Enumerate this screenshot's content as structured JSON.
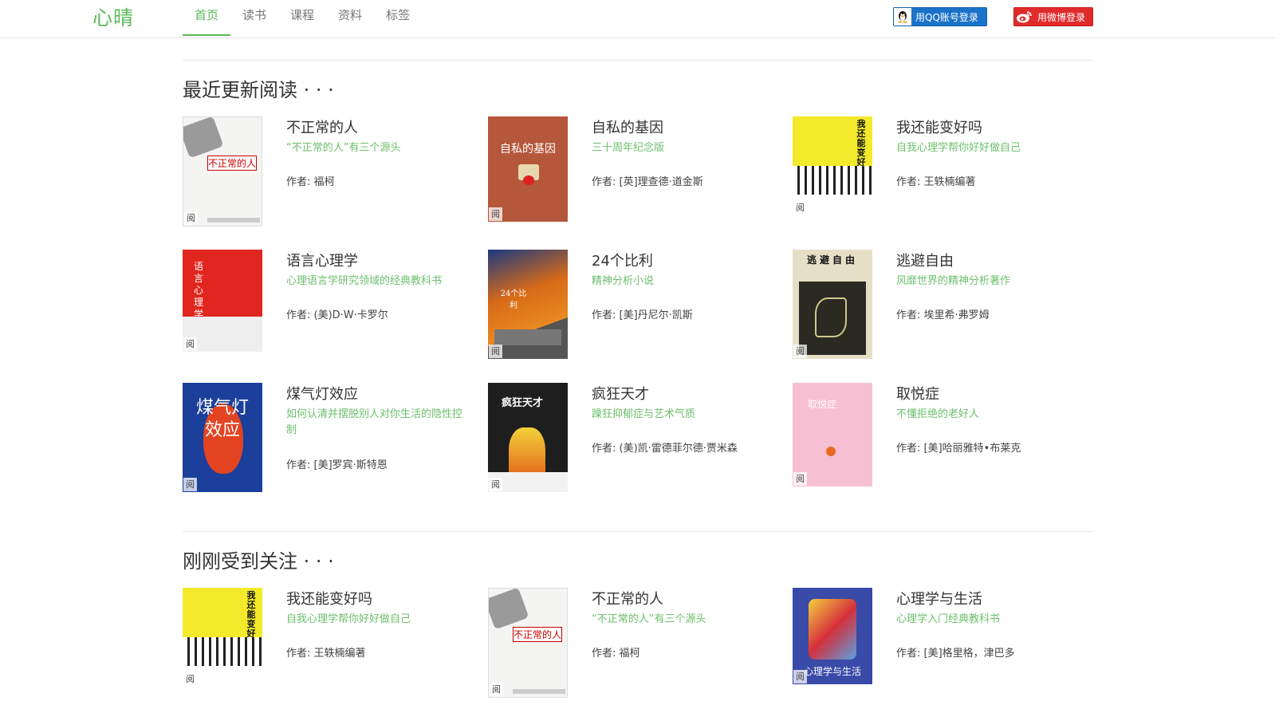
{
  "header": {
    "logo": "心晴",
    "nav": [
      "首页",
      "读书",
      "课程",
      "资料",
      "标签"
    ],
    "login_qq": "用QQ账号登录",
    "login_weibo": "用微博登录"
  },
  "sections": {
    "recent": {
      "title": "最近更新阅读 · · ·",
      "books": [
        {
          "title": "不正常的人",
          "subtitle": "“不正常的人”有三个源头",
          "author": "作者: 福柯",
          "cover_text": "不正常的人"
        },
        {
          "title": "自私的基因",
          "subtitle": "三十周年纪念版",
          "author": "作者: [英]理查德·道金斯",
          "cover_text": "自私的基因"
        },
        {
          "title": "我还能变好吗",
          "subtitle": "自我心理学帮你好好做自己",
          "author": "作者: 王轶楠编著",
          "cover_text": "我还能变好吗"
        },
        {
          "title": "语言心理学",
          "subtitle": "心理语言学研究领域的经典教科书",
          "author": "作者: (美)D·W·卡罗尔",
          "cover_text": "语言心理学"
        },
        {
          "title": "24个比利",
          "subtitle": "精神分析小说",
          "author": "作者: [美]丹尼尔·凯斯",
          "cover_text": "24个比利"
        },
        {
          "title": "逃避自由",
          "subtitle": "风靡世界的精神分析著作",
          "author": "作者: 埃里希·弗罗姆",
          "cover_text": "逃避自由"
        },
        {
          "title": "煤气灯效应",
          "subtitle": "如何认清并摆脱别人对你生活的隐性控制",
          "author": "作者: [美]罗宾·斯特恩",
          "cover_text": "煤气灯效应"
        },
        {
          "title": "疯狂天才",
          "subtitle": "躁狂抑郁症与艺术气质",
          "author": "作者: (美)凯·雷德菲尔德·贾米森",
          "cover_text": "疯狂天才"
        },
        {
          "title": "取悦症",
          "subtitle": "不懂拒绝的老好人",
          "author": "作者: [美]哈丽雅特•布莱克",
          "cover_text": "取悦症"
        }
      ]
    },
    "popular": {
      "title": "刚刚受到关注 · · ·",
      "books": [
        {
          "title": "我还能变好吗",
          "subtitle": "自我心理学帮你好好做自己",
          "author": "作者: 王轶楠编著",
          "cover_text": "我还能变好吗"
        },
        {
          "title": "不正常的人",
          "subtitle": "“不正常的人”有三个源头",
          "author": "作者: 福柯",
          "cover_text": "不正常的人"
        },
        {
          "title": "心理学与生活",
          "subtitle": "心理学入门经典教科书",
          "author": "作者: [美]格里格，津巴多",
          "cover_text": "心理学与生活"
        }
      ]
    }
  },
  "read_tag": "阅",
  "colors": {
    "accent": "#5cb85c",
    "subtitle": "#6dbf6d",
    "qq": "#1b73c9",
    "weibo": "#e02b2b"
  }
}
